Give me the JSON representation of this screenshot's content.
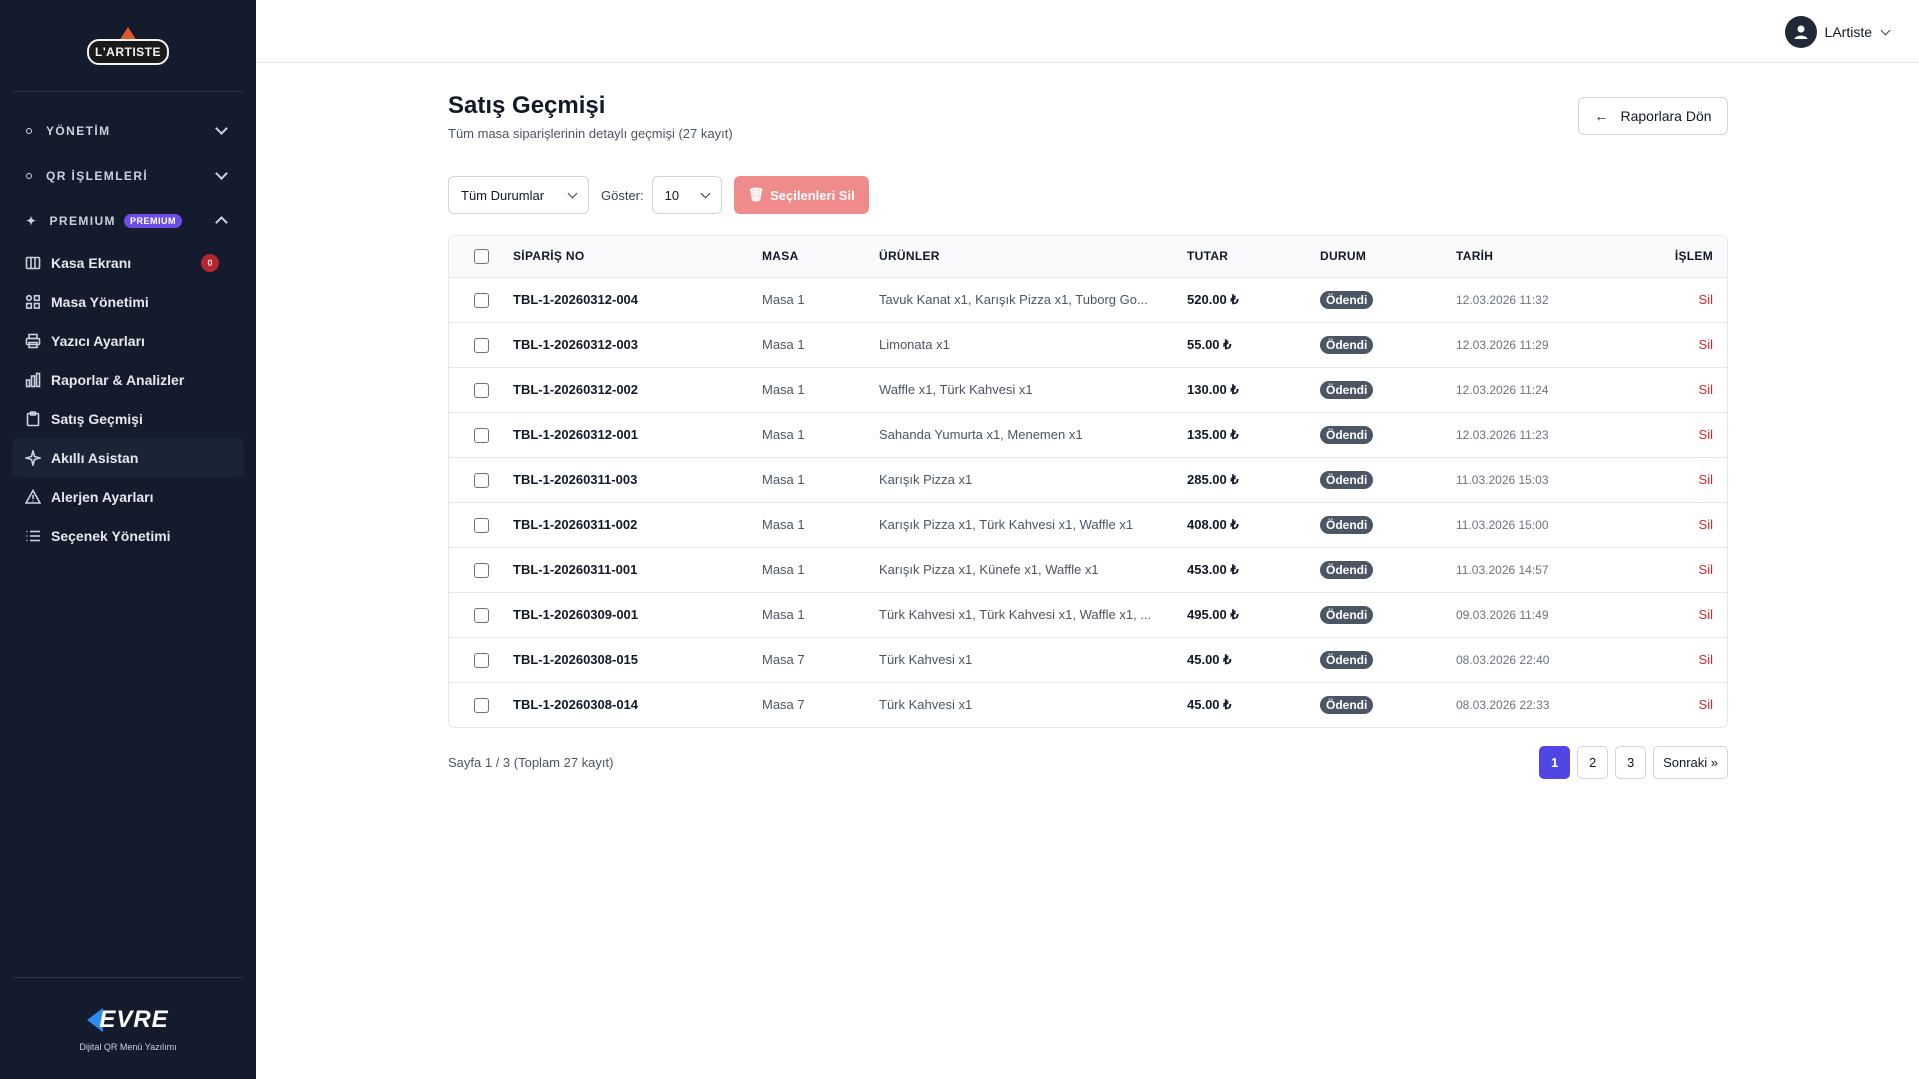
{
  "brand": {
    "logo_text": "L'ARTISTE",
    "footer_logo_text": "EVRE",
    "footer_caption": "Dijital QR Menü Yazılımı"
  },
  "sidebar": {
    "groups": [
      {
        "label": "YÖNETİM"
      },
      {
        "label": "QR İŞLEMLERİ"
      },
      {
        "label": "PREMIUM",
        "badge": "PREMIUM"
      }
    ],
    "items": [
      {
        "label": "Kasa Ekranı",
        "icon": "columns-icon",
        "badge": "0"
      },
      {
        "label": "Masa Yönetimi",
        "icon": "grid-icon"
      },
      {
        "label": "Yazıcı Ayarları",
        "icon": "printer-icon"
      },
      {
        "label": "Raporlar & Analizler",
        "icon": "bar-chart-icon"
      },
      {
        "label": "Satış Geçmişi",
        "icon": "clipboard-icon"
      },
      {
        "label": "Akıllı Asistan",
        "icon": "sparkle-icon"
      },
      {
        "label": "Alerjen Ayarları",
        "icon": "warning-icon"
      },
      {
        "label": "Seçenek Yönetimi",
        "icon": "list-icon"
      }
    ]
  },
  "topbar": {
    "username": "LArtiste"
  },
  "page": {
    "title": "Satış Geçmişi",
    "subtitle": "Tüm masa siparişlerinin detaylı geçmişi (27 kayıt)",
    "back_button": "Raporlara Dön"
  },
  "filters": {
    "status_value": "Tüm Durumlar",
    "show_label": "Göster:",
    "per_page_value": "10",
    "delete_selected": "Seçilenleri Sil"
  },
  "table": {
    "headers": {
      "order_no": "SİPARİŞ NO",
      "table": "MASA",
      "items": "ÜRÜNLER",
      "total": "TUTAR",
      "status": "DURUM",
      "date": "TARİH",
      "action": "İŞLEM"
    },
    "rows": [
      {
        "order_no": "TBL-1-20260312-004",
        "table": "Masa 1",
        "items": "Tavuk Kanat x1, Karışık Pizza x1, Tuborg Go...",
        "total": "520.00 ₺",
        "status": "Ödendi",
        "date": "12.03.2026 11:32",
        "action": "Sil"
      },
      {
        "order_no": "TBL-1-20260312-003",
        "table": "Masa 1",
        "items": "Limonata x1",
        "total": "55.00 ₺",
        "status": "Ödendi",
        "date": "12.03.2026 11:29",
        "action": "Sil"
      },
      {
        "order_no": "TBL-1-20260312-002",
        "table": "Masa 1",
        "items": "Waffle x1, Türk Kahvesi x1",
        "total": "130.00 ₺",
        "status": "Ödendi",
        "date": "12.03.2026 11:24",
        "action": "Sil"
      },
      {
        "order_no": "TBL-1-20260312-001",
        "table": "Masa 1",
        "items": "Sahanda Yumurta x1, Menemen x1",
        "total": "135.00 ₺",
        "status": "Ödendi",
        "date": "12.03.2026 11:23",
        "action": "Sil"
      },
      {
        "order_no": "TBL-1-20260311-003",
        "table": "Masa 1",
        "items": "Karışık Pizza x1",
        "total": "285.00 ₺",
        "status": "Ödendi",
        "date": "11.03.2026 15:03",
        "action": "Sil"
      },
      {
        "order_no": "TBL-1-20260311-002",
        "table": "Masa 1",
        "items": "Karışık Pizza x1, Türk Kahvesi x1, Waffle x1",
        "total": "408.00 ₺",
        "status": "Ödendi",
        "date": "11.03.2026 15:00",
        "action": "Sil"
      },
      {
        "order_no": "TBL-1-20260311-001",
        "table": "Masa 1",
        "items": "Karışık Pizza x1, Künefe x1, Waffle x1",
        "total": "453.00 ₺",
        "status": "Ödendi",
        "date": "11.03.2026 14:57",
        "action": "Sil"
      },
      {
        "order_no": "TBL-1-20260309-001",
        "table": "Masa 1",
        "items": "Türk Kahvesi x1, Türk Kahvesi x1, Waffle x1, ...",
        "total": "495.00 ₺",
        "status": "Ödendi",
        "date": "09.03.2026 11:49",
        "action": "Sil"
      },
      {
        "order_no": "TBL-1-20260308-015",
        "table": "Masa 7",
        "items": "Türk Kahvesi x1",
        "total": "45.00 ₺",
        "status": "Ödendi",
        "date": "08.03.2026 22:40",
        "action": "Sil"
      },
      {
        "order_no": "TBL-1-20260308-014",
        "table": "Masa 7",
        "items": "Türk Kahvesi x1",
        "total": "45.00 ₺",
        "status": "Ödendi",
        "date": "08.03.2026 22:33",
        "action": "Sil"
      }
    ]
  },
  "pagination": {
    "info": "Sayfa 1 / 3 (Toplam 27 kayıt)",
    "pages": [
      "1",
      "2",
      "3"
    ],
    "current": "1",
    "next": "Sonraki »"
  },
  "colors": {
    "sidebar_bg": "#141b2d",
    "accent": "#4f46e5",
    "danger": "#dc2626",
    "premium": "#6d4ee6"
  }
}
